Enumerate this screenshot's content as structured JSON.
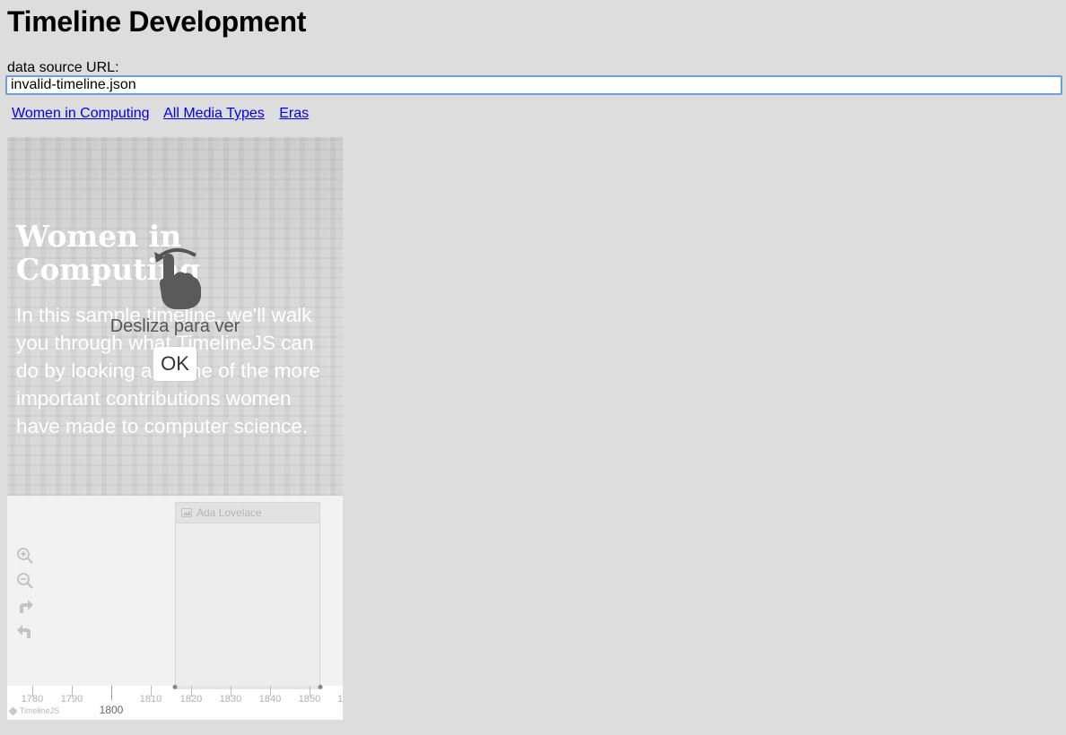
{
  "page": {
    "title": "Timeline Development"
  },
  "data_source": {
    "label": "data source URL:",
    "value": "invalid-timeline.json"
  },
  "links": [
    "Women in Computing",
    "All Media Types",
    "Eras"
  ],
  "slide": {
    "title": "Women in Computing",
    "text": "In this sample timeline, we'll walk you through what TimelineJS can do by looking at some of the more important contributions women have made to computer science."
  },
  "swipe_overlay": {
    "message": "Desliza para ver",
    "ok_label": "OK"
  },
  "tools": [
    "zoom-in-icon",
    "zoom-out-icon",
    "forward-icon",
    "back-icon"
  ],
  "marker": {
    "label": "Ada Lovelace",
    "icon": "image-icon"
  },
  "axis": {
    "ticks": [
      "1780",
      "1790",
      "1800",
      "1810",
      "1820",
      "1830",
      "1840",
      "1850",
      "1"
    ],
    "major_tick": "1800"
  },
  "brand": "TimelineJS",
  "colors": {
    "link": "#0000ee",
    "input_focus": "#6d9fe0",
    "background": "#dddddd"
  }
}
